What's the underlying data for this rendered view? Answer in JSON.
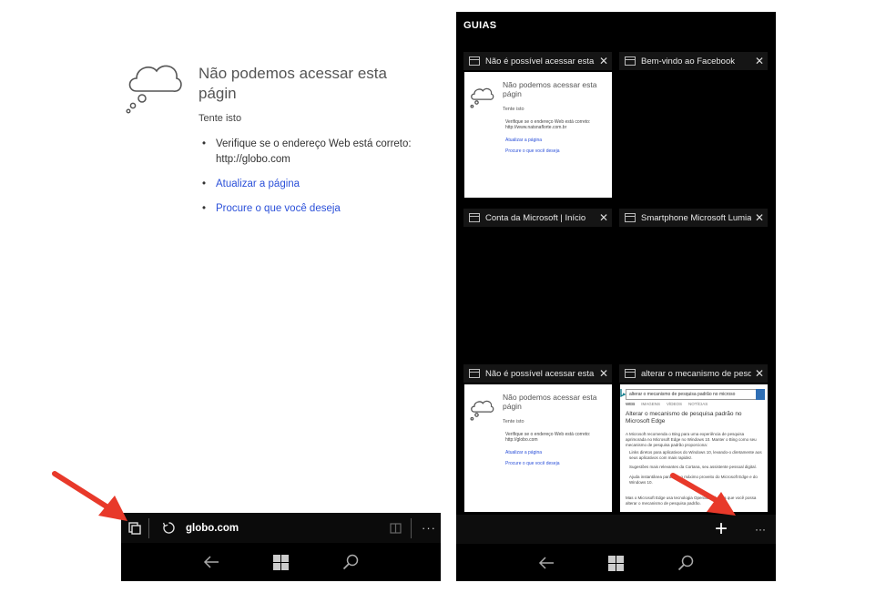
{
  "left_page": {
    "error_title": "Não podemos acessar esta págin",
    "hint": "Tente isto",
    "bullet1": "Verifique se o endereço Web está correto: http://globo.com",
    "bullet2": "Atualizar a página",
    "bullet3": "Procure o que você deseja"
  },
  "address_bar": {
    "url": "globo.com",
    "more": "···"
  },
  "tabs_view": {
    "title": "GUIAS",
    "tiles": [
      {
        "title": "Não é possível acessar esta pá",
        "close": "✕"
      },
      {
        "title": "Bem-vindo ao Facebook",
        "close": "✕"
      },
      {
        "title": "Conta da Microsoft | Início",
        "close": "✕"
      },
      {
        "title": "Smartphone Microsoft Lumia",
        "close": "✕"
      },
      {
        "title": "Não é possível acessar esta pá",
        "close": "✕"
      },
      {
        "title": "alterar o mecanismo de pesqu",
        "close": "✕"
      }
    ],
    "mini1": {
      "title": "Não podemos acessar esta págin",
      "hint": "Tente isto",
      "b1": "Verifique se o endereço Web está correto: http://www.natsnaflorte.com.br",
      "b2": "Atualizar a página",
      "b3": "Procure o que você deseja"
    },
    "mini2": {
      "title": "Não podemos acessar esta págin",
      "hint": "Tente isto",
      "b1": "Verifique se o endereço Web está correto: http://globo.com",
      "b2": "Atualizar a página",
      "b3": "Procure o que você deseja"
    },
    "bing": {
      "query": "alterar o mecanismo de pesquisa padrão no microso",
      "tab_web": "WEB",
      "tab_images": "IMAGENS",
      "tab_videos": "VÍDEOS",
      "tab_news": "NOTÍCIAS",
      "heading": "Alterar o mecanismo de pesquisa padrão no Microsoft Edge",
      "p1": "A Microsoft recomenda o Bing para uma experiência de pesquisa aprimorada no Microsoft Edge no Windows 10. Manter o Bing como seu mecanismo de pesquisa padrão proporciona:",
      "l1": "Links diretos para aplicativos do Windows 10, levando-o diretamente aos seus aplicativos com mais rapidez.",
      "l2": "Sugestões mais relevantes da Cortana, seu assistente pessoal digital.",
      "l3": "Ajuda instantânea para tirar o máximo proveito do Microsoft Edge e do Windows 10.",
      "p2": "Mas o Microsoft Edge usa tecnologia OpenSearch para que você possa alterar o mecanismo de pesquisa padrão."
    },
    "add": "+",
    "more": "···"
  },
  "colors": {
    "arrow": "#e8392a",
    "link": "#2b50d9",
    "bing_blue": "#2f6fb5"
  }
}
